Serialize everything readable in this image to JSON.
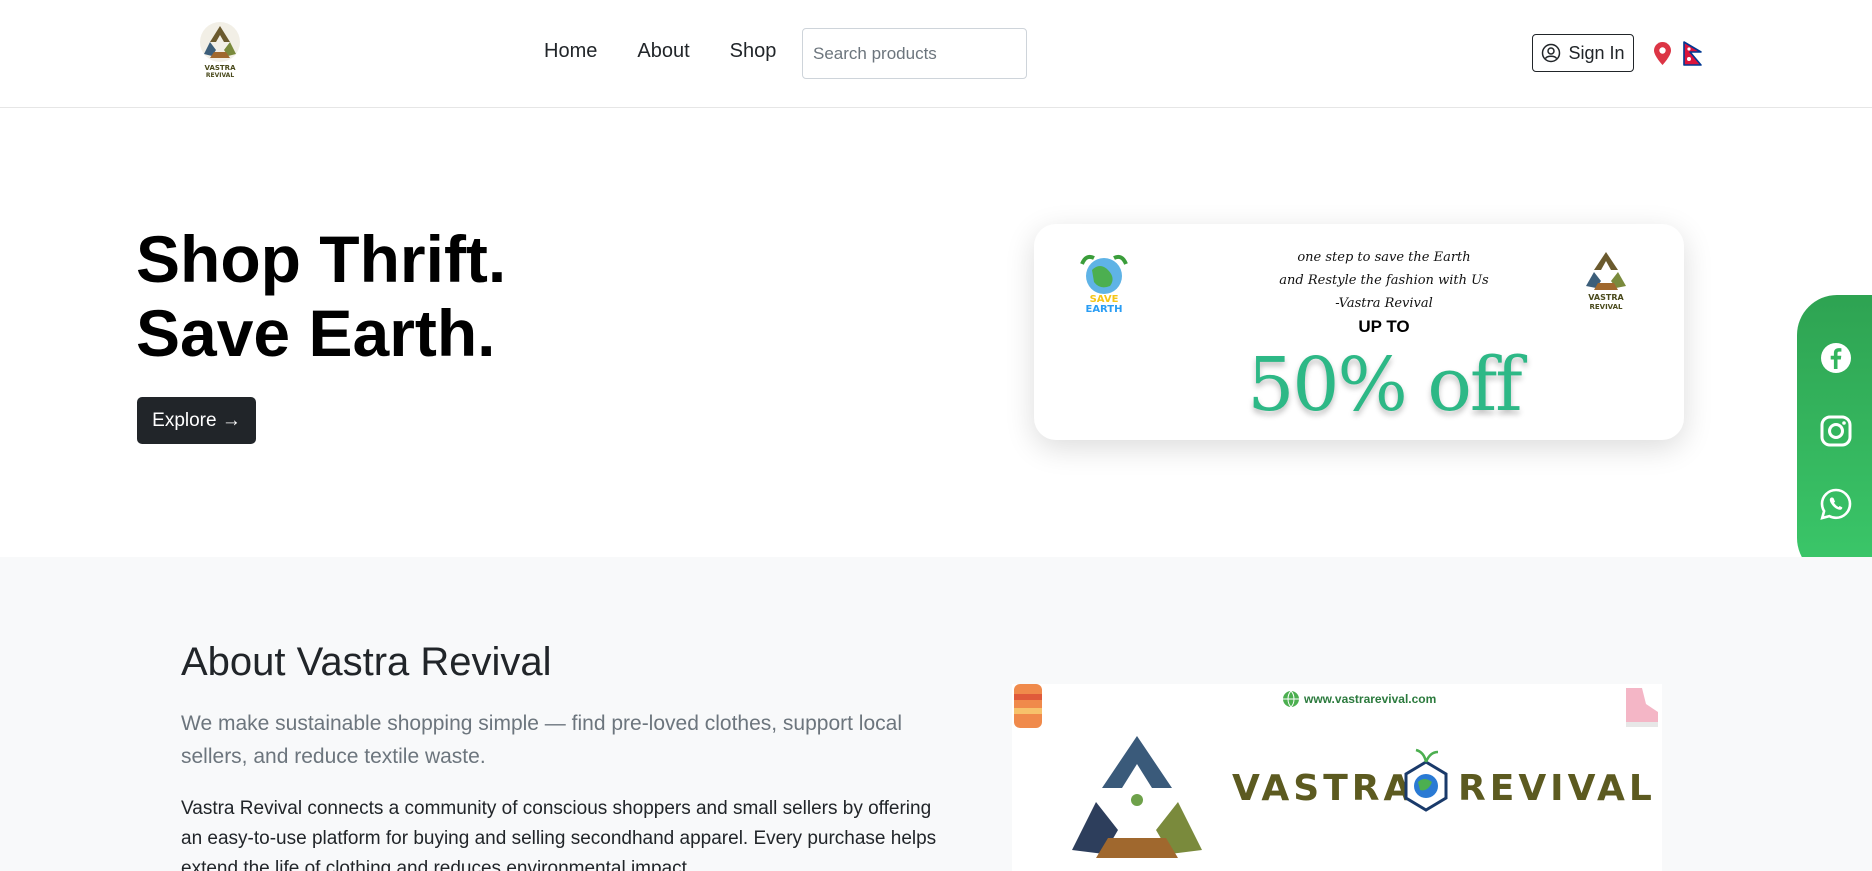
{
  "header": {
    "logo_text": "VASTRA REVIVAL",
    "nav": [
      {
        "label": "Home"
      },
      {
        "label": "About"
      },
      {
        "label": "Shop"
      }
    ],
    "search_placeholder": "Search products",
    "signin_label": "Sign In"
  },
  "hero": {
    "title_line1": "Shop Thrift.",
    "title_line2": "Save Earth.",
    "explore_label": "Explore →"
  },
  "banner": {
    "left_badge_text": "SAVE EARTH",
    "quote_line1": "one step to save the Earth",
    "quote_line2": "and Restyle the fashion with Us",
    "quote_line3": "-Vastra Revival",
    "upto": "UP TO",
    "offer": "50% off",
    "right_logo_text": "VASTRA REVIVAL"
  },
  "social": {
    "icons": [
      "facebook-icon",
      "instagram-icon",
      "whatsapp-icon"
    ],
    "color": "#33b55e"
  },
  "about": {
    "title": "About Vastra Revival",
    "lead": "We make sustainable shopping simple — find pre-loved clothes, support local sellers, and reduce textile waste.",
    "body": "Vastra Revival connects a community of conscious shoppers and small sellers by offering an easy-to-use platform for buying and selling secondhand apparel. Every purchase helps extend the life of clothing and reduces environmental impact.",
    "image": {
      "url_text": "www.vastrarevival.com",
      "brand_left": "VASTRA",
      "brand_right": "REVIVAL"
    }
  },
  "colors": {
    "dark": "#212529",
    "offer_green": "#2db886",
    "location_pin": "#dc3545",
    "flag_red": "#dc143c",
    "flag_blue": "#003893"
  }
}
